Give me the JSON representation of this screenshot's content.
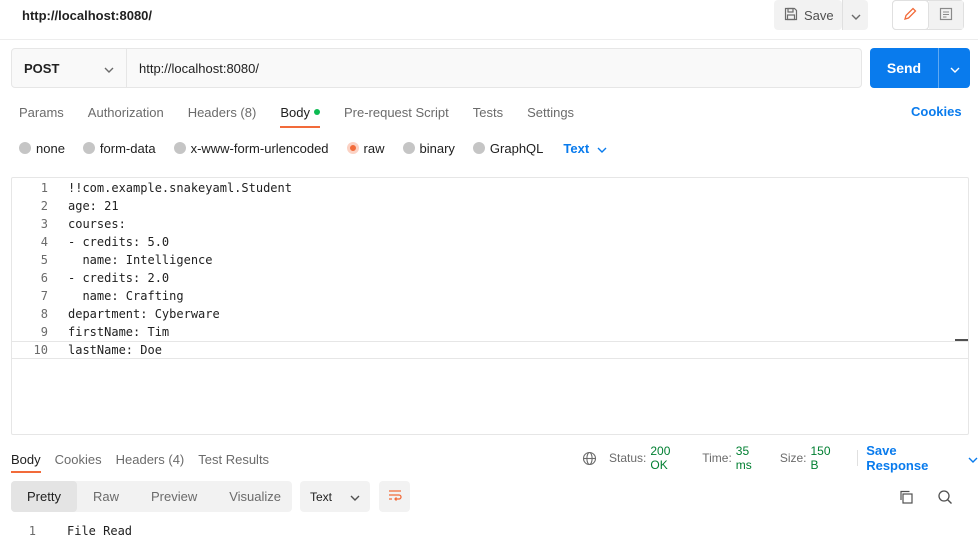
{
  "tab": {
    "title": "http://localhost:8080/"
  },
  "toolbar": {
    "save_label": "Save"
  },
  "request": {
    "method": "POST",
    "url": "http://localhost:8080/",
    "send_label": "Send"
  },
  "request_tabs": [
    {
      "label": "Params"
    },
    {
      "label": "Authorization"
    },
    {
      "label": "Headers (8)"
    },
    {
      "label": "Body"
    },
    {
      "label": "Pre-request Script"
    },
    {
      "label": "Tests"
    },
    {
      "label": "Settings"
    }
  ],
  "cookies_label": "Cookies",
  "body_types": [
    {
      "label": "none"
    },
    {
      "label": "form-data"
    },
    {
      "label": "x-www-form-urlencoded"
    },
    {
      "label": "raw"
    },
    {
      "label": "binary"
    },
    {
      "label": "GraphQL"
    }
  ],
  "body_format": "Text",
  "code_lines": [
    {
      "n": "1",
      "text": "!!com.example.snakeyaml.Student"
    },
    {
      "n": "2",
      "text": "age: 21"
    },
    {
      "n": "3",
      "text": "courses:"
    },
    {
      "n": "4",
      "text": "- credits: 5.0"
    },
    {
      "n": "5",
      "text": "  name: Intelligence"
    },
    {
      "n": "6",
      "text": "- credits: 2.0"
    },
    {
      "n": "7",
      "text": "  name: Crafting"
    },
    {
      "n": "8",
      "text": "department: Cyberware"
    },
    {
      "n": "9",
      "text": "firstName: Tim"
    },
    {
      "n": "10",
      "text": "lastName: Doe"
    }
  ],
  "response_tabs": [
    {
      "label": "Body"
    },
    {
      "label": "Cookies"
    },
    {
      "label": "Headers (4)"
    },
    {
      "label": "Test Results"
    }
  ],
  "response_meta": {
    "status_label": "Status:",
    "status_value": "200 OK",
    "time_label": "Time:",
    "time_value": "35 ms",
    "size_label": "Size:",
    "size_value": "150 B",
    "save_response": "Save Response"
  },
  "view_modes": [
    {
      "label": "Pretty"
    },
    {
      "label": "Raw"
    },
    {
      "label": "Preview"
    },
    {
      "label": "Visualize"
    }
  ],
  "response_format": "Text",
  "response_lines": [
    {
      "n": "1",
      "text": "File Read"
    }
  ],
  "colors": {
    "accent": "#097bed",
    "active_tab": "#f26b3a",
    "status_ok": "#007f31"
  }
}
